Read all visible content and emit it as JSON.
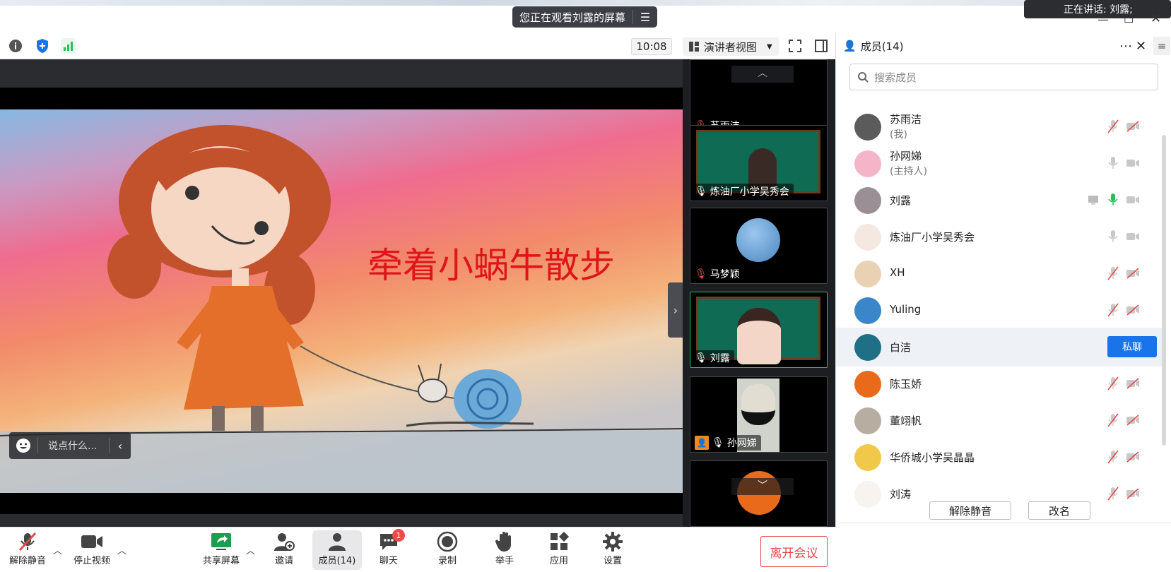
{
  "window": {
    "banner_text": "您正在观看刘露的屏幕",
    "speaking_text": "正在讲话: 刘露;"
  },
  "toolbar": {
    "timer": "10:08",
    "view_mode": "演讲者视图"
  },
  "share": {
    "title_text": "牵着小蜗牛散步",
    "chat_placeholder": "说点什么..."
  },
  "thumbnails": [
    {
      "name": "苏雨洁",
      "mic": "muted"
    },
    {
      "name": "炼油厂小学吴秀会",
      "mic": "on"
    },
    {
      "name": "马梦颖",
      "mic": "muted"
    },
    {
      "name": "刘露",
      "mic": "on"
    },
    {
      "name": "孙网娣",
      "mic": "on"
    }
  ],
  "members_panel": {
    "title": "成员(14)",
    "search_placeholder": "搜索成员",
    "members": [
      {
        "name": "苏雨洁",
        "role": "(我)",
        "mic": "muted",
        "cam": "off",
        "avatar_color": "#5b5b5b"
      },
      {
        "name": "孙网娣",
        "role": "(主持人)",
        "mic": "on",
        "cam": "off",
        "avatar_color": "#f5b5c8"
      },
      {
        "name": "刘露",
        "role": "",
        "mic": "speaking",
        "cam": "off",
        "avatar_color": "#9a8f95"
      },
      {
        "name": "炼油厂小学吴秀会",
        "role": "",
        "mic": "on",
        "cam": "off",
        "avatar_color": "#f4e8e0"
      },
      {
        "name": "XH",
        "role": "",
        "mic": "muted",
        "cam": "off",
        "avatar_color": "#e9d2b4"
      },
      {
        "name": "Yuling",
        "role": "",
        "mic": "muted",
        "cam": "off",
        "avatar_color": "#3a86c8"
      },
      {
        "name": "白洁",
        "role": "",
        "mic": "",
        "cam": "",
        "avatar_color": "#1f6f86"
      },
      {
        "name": "陈玉娇",
        "role": "",
        "mic": "muted",
        "cam": "off",
        "avatar_color": "#e86a1a"
      },
      {
        "name": "董翊帆",
        "role": "",
        "mic": "muted",
        "cam": "off",
        "avatar_color": "#b7ada0"
      },
      {
        "name": "华侨城小学吴晶晶",
        "role": "",
        "mic": "muted",
        "cam": "off",
        "avatar_color": "#f1c94a"
      },
      {
        "name": "刘涛",
        "role": "",
        "mic": "muted",
        "cam": "off",
        "avatar_color": "#f7f3ee"
      }
    ],
    "dm_label": "私聊",
    "unmute_all": "解除静音",
    "rename": "改名"
  },
  "controls": {
    "unmute": "解除静音",
    "stop_video": "停止视频",
    "share_screen": "共享屏幕",
    "invite": "邀请",
    "members": "成员(14)",
    "chat": "聊天",
    "chat_badge": "1",
    "record": "录制",
    "raise_hand": "举手",
    "apps": "应用",
    "settings": "设置",
    "leave": "离开会议"
  },
  "colors": {
    "accent": "#1a73e8",
    "danger": "#e54848",
    "active_green": "#2dbd5a"
  }
}
